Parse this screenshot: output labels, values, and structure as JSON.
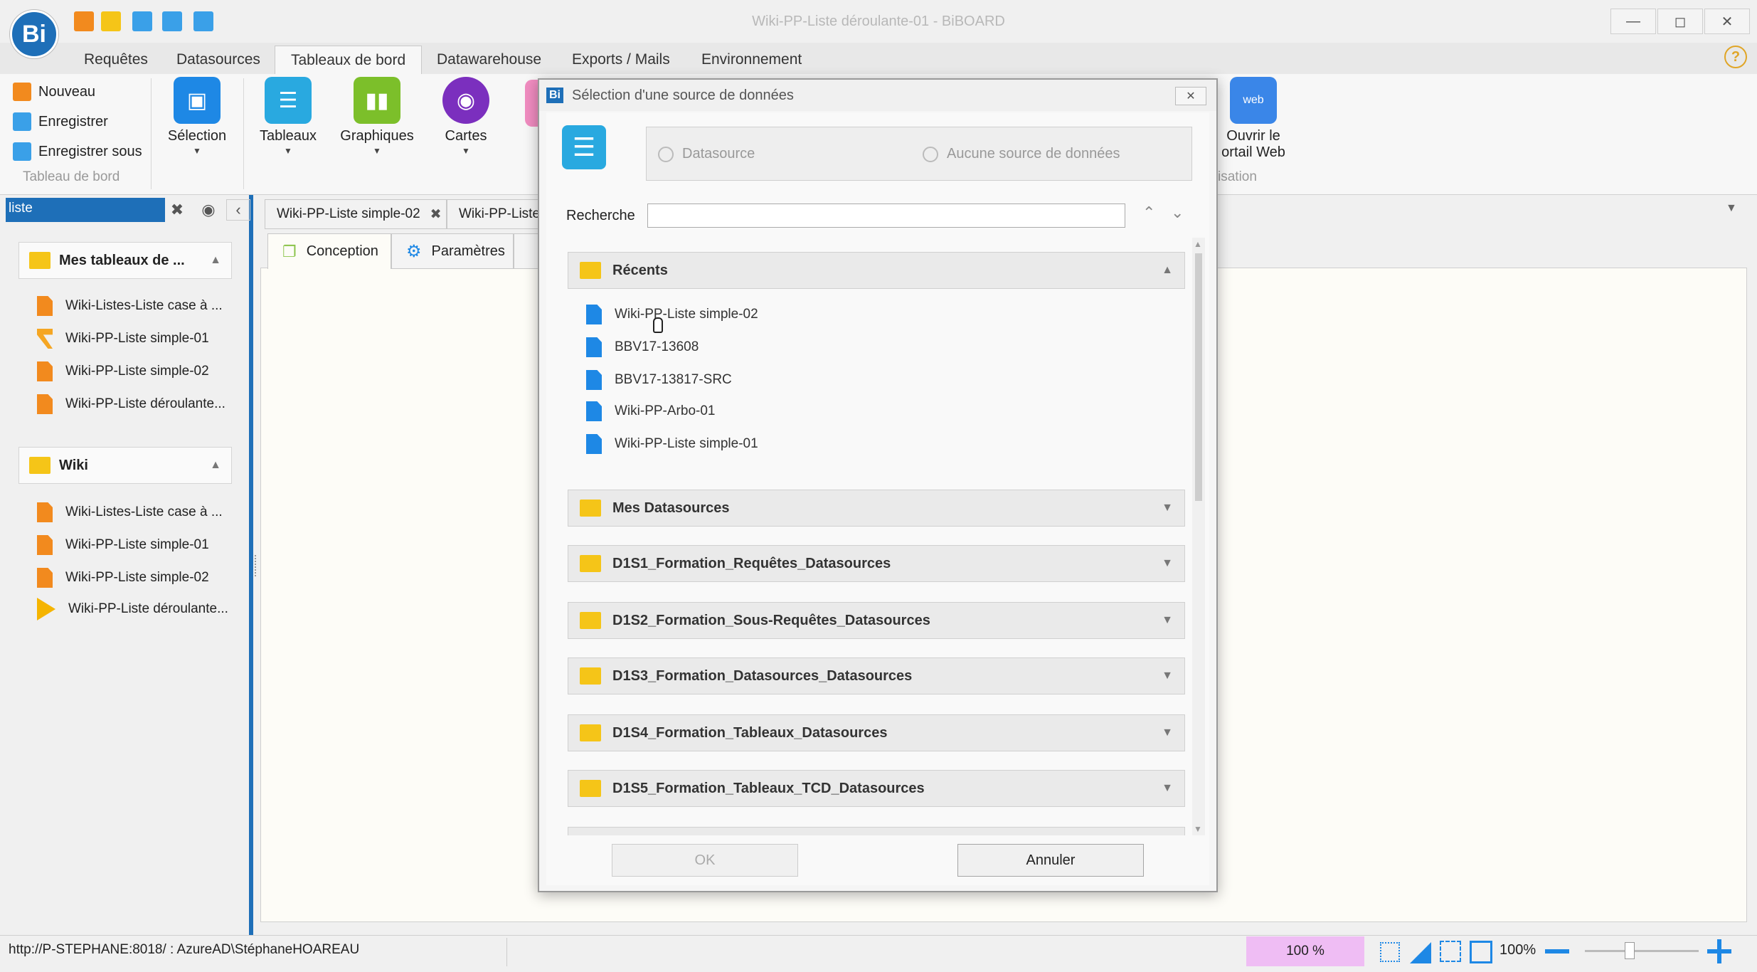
{
  "window": {
    "title": "Wiki-PP-Liste déroulante-01 - BiBOARD",
    "logo": "Bi"
  },
  "menu": [
    "Requêtes",
    "Datasources",
    "Tableaux de bord",
    "Datawarehouse",
    "Exports / Mails",
    "Environnement"
  ],
  "help": "?",
  "ribbon": {
    "nouveau": "Nouveau",
    "enregistrer": "Enregistrer",
    "enregistrer_sous": "Enregistrer sous",
    "group1": "Tableau de bord",
    "selection": "Sélection",
    "tableaux": "Tableaux",
    "graphiques": "Graphiques",
    "cartes": "Cartes",
    "portail_line1": "Ouvrir le",
    "portail_line2": "ortail Web",
    "group_right": "isation"
  },
  "left": {
    "filter": "liste",
    "section1": "Mes tableaux de ...",
    "section1_items": [
      "Wiki-Listes-Liste case à ...",
      "Wiki-PP-Liste simple-01",
      "Wiki-PP-Liste simple-02",
      "Wiki-PP-Liste déroulante..."
    ],
    "section2": "Wiki",
    "section2_items": [
      "Wiki-Listes-Liste case à ...",
      "Wiki-PP-Liste simple-01",
      "Wiki-PP-Liste simple-02",
      "Wiki-PP-Liste déroulante..."
    ]
  },
  "doctabs": [
    "Wiki-PP-Liste simple-02",
    "Wiki-PP-Liste"
  ],
  "subtabs": [
    "Conception",
    "Paramètres"
  ],
  "dialog": {
    "title": "Sélection d'une source de données",
    "opt_datasource": "Datasource",
    "opt_none": "Aucune source de données",
    "search_label": "Recherche",
    "search_value": "",
    "recent_header": "Récents",
    "recent_items": [
      "Wiki-PP-Liste simple-02",
      "BBV17-13608",
      "BBV17-13817-SRC",
      "Wiki-PP-Arbo-01",
      "Wiki-PP-Liste simple-01"
    ],
    "categories": [
      "Mes Datasources",
      "D1S1_Formation_Requêtes_Datasources",
      "D1S2_Formation_Sous-Requêtes_Datasources",
      "D1S3_Formation_Datasources_Datasources",
      "D1S4_Formation_Tableaux_Datasources",
      "D1S5_Formation_Tableaux_TCD_Datasources"
    ],
    "ok": "OK",
    "cancel": "Annuler"
  },
  "status": {
    "url": "http://P-STEPHANE:8018/ : AzureAD\\StéphaneHOAREAU",
    "zoom": "100 %",
    "zoom2": "100%"
  },
  "colors": {
    "accent": "#1e6fb8",
    "folder": "#f5c518",
    "doc_orange": "#f28a1e",
    "doc_blue": "#1e88e5"
  }
}
